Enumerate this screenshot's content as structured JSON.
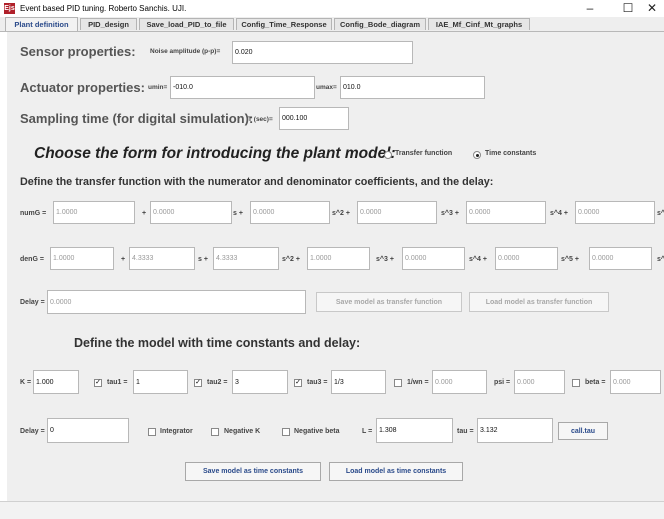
{
  "window": {
    "icon_text": "Ejs",
    "title": "Event based PID tuning. Roberto Sanchis. UJI.",
    "minimize": "–",
    "maximize": "☐",
    "close": "✕"
  },
  "tabs": [
    {
      "label": "Plant definition"
    },
    {
      "label": "PID_design"
    },
    {
      "label": "Save_load_PID_to_file"
    },
    {
      "label": "Config_Time_Response"
    },
    {
      "label": "Config_Bode_diagram"
    },
    {
      "label": "IAE_Mf_Cinf_Mt_graphs"
    }
  ],
  "sensor": {
    "heading": "Sensor properties:",
    "noise_label": "Noise amplitude (p-p)=",
    "noise_value": "0.020"
  },
  "actuator": {
    "heading": "Actuator properties:",
    "umin_label": "umin=",
    "umin_value": "-010.0",
    "umax_label": "umax=",
    "umax_value": "010.0"
  },
  "sampling": {
    "heading": "Sampling time (for digital simulation):",
    "label": "T (sec)=",
    "value": "000.100"
  },
  "plant_form": {
    "heading": "Choose the form for introducing the plant model:",
    "option_tf": "Transfer function",
    "option_tc": "Time constants",
    "selected": "Time constants"
  },
  "tf": {
    "heading": "Define the transfer function with the numerator and denominator coefficients, and the delay:",
    "num_label": "numG =",
    "num": [
      "1.0000",
      "0.0000",
      "0.0000",
      "0.0000",
      "0.0000",
      "0.0000"
    ],
    "num_ops": [
      "+",
      "s +",
      "s^2 +",
      "s^3 +",
      "s^4 +",
      "s^"
    ],
    "den_label": "denG =",
    "den": [
      "1.0000",
      "4.3333",
      "4.3333",
      "1.0000",
      "0.0000",
      "0.0000",
      "0.0000"
    ],
    "den_ops": [
      "+",
      "s +",
      "s^2 +",
      "s^3 +",
      "s^4 +",
      "s^5 +",
      "s^"
    ],
    "delay_label": "Delay =",
    "delay_value": "0.0000",
    "save_button": "Save model as transfer function",
    "load_button": "Load model as transfer function"
  },
  "tc": {
    "heading": "Define the model with time constants and delay:",
    "k_label": "K =",
    "k_value": "1.000",
    "tau1_label": "tau1 =",
    "tau1_value": "1",
    "tau1_checked": true,
    "tau2_label": "tau2 =",
    "tau2_value": "3",
    "tau2_checked": true,
    "tau3_label": "tau3 =",
    "tau3_value": "1/3",
    "tau3_checked": true,
    "wn_label": "1/wn =",
    "wn_value": "0.000",
    "wn_checked": false,
    "psi_label": "psi =",
    "psi_value": "0.000",
    "beta_label": "beta =",
    "beta_value": "0.000",
    "beta_checked": false,
    "delay_label": "Delay =",
    "delay_value": "0",
    "integrator_label": "Integrator",
    "negative_k_label": "Negative K",
    "negative_beta_label": "Negative beta",
    "l_label": "L =",
    "l_value": "1.308",
    "tau_label": "tau =",
    "tau_value": "3.132",
    "calc_button": "call.tau",
    "save_button": "Save model as time constants",
    "load_button": "Load model as time constants"
  }
}
